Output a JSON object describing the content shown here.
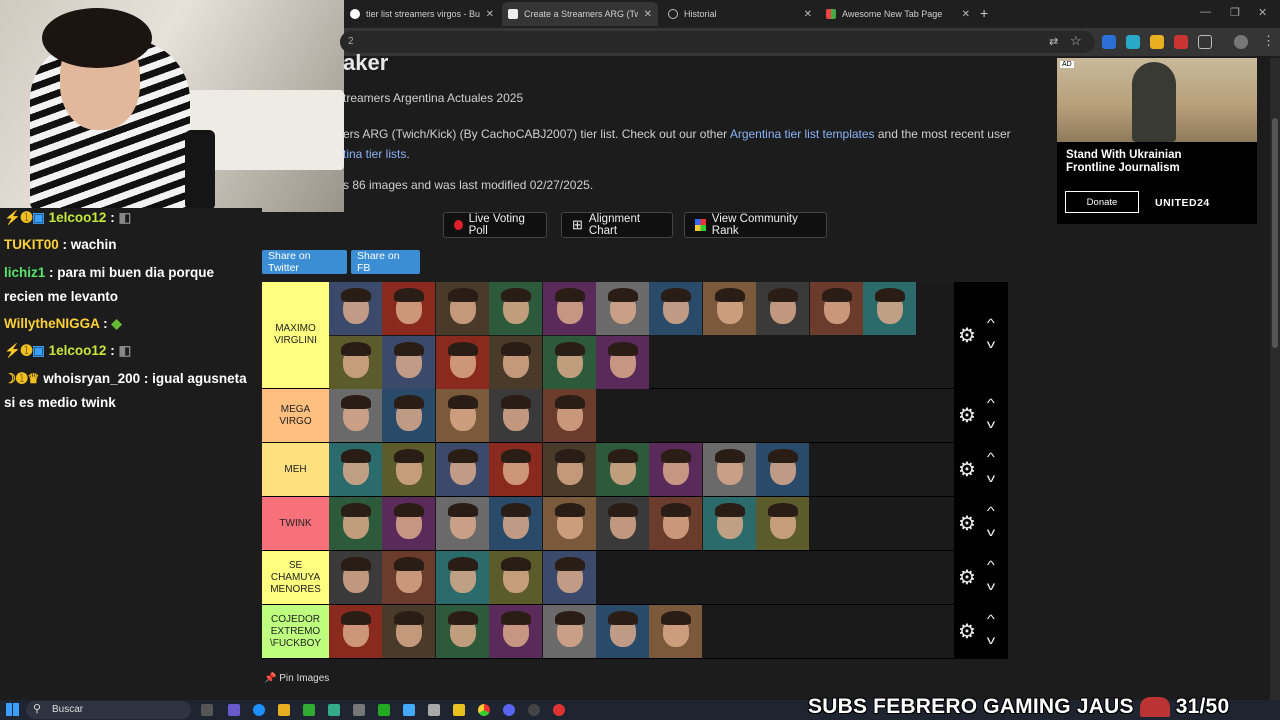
{
  "browser": {
    "tabs": [
      {
        "label": "tier list streamers virgos - Busca",
        "active": false
      },
      {
        "label": "Create a Streamers ARG (Twich/Kick)",
        "active": true
      },
      {
        "label": "Historial",
        "active": false
      },
      {
        "label": "Awesome New Tab Page",
        "active": false
      }
    ],
    "new_tab": "+",
    "url_fragment": "2"
  },
  "page": {
    "title_fragment": "aker",
    "subtitle": "treamers Argentina Actuales 2025",
    "desc_part1": "ers ARG (Twich/Kick) (By CachoCABJ2007) tier list. Check out our other ",
    "desc_link1": "Argentina tier list templates",
    "desc_part2": " and the most recent user",
    "desc_link2": "tina tier lists",
    "desc_part3": ".",
    "meta": "s 86 images and was last modified 02/27/2025.",
    "buttons": {
      "live_voting": "Live Voting Poll",
      "alignment": "Alignment Chart",
      "community": "View Community Rank"
    },
    "share": {
      "twitter": "Share on Twitter",
      "fb": "Share on FB"
    },
    "tiers": [
      {
        "label": "MAXIMO VIRGLINI",
        "color": "#ffff7f",
        "count": 17
      },
      {
        "label": "MEGA VIRGO",
        "color": "#ffbf7f",
        "count": 5
      },
      {
        "label": "MEH",
        "color": "#ffdf7f",
        "count": 9
      },
      {
        "label": "TWINK",
        "color": "#f7707a",
        "count": 9
      },
      {
        "label": "SE CHAMUYA MENORES",
        "color": "#ffff7f",
        "count": 5
      },
      {
        "label": "COJEDOR EXTREMO \\FUCKBOY",
        "color": "#bfff7f",
        "count": 7
      }
    ],
    "pin_images": "Pin Images"
  },
  "ad": {
    "tag": "AD",
    "headline": "Stand With Ukrainian Frontline Journalism",
    "donate": "Donate",
    "brand": "UNITED24"
  },
  "chat": [
    {
      "user": "1elcoo12",
      "text": "",
      "color": "#c6e83a"
    },
    {
      "user": "TUKIT00",
      "text": "wachin",
      "color": "#ffd23a"
    },
    {
      "user": "lichiz1",
      "text": "para mi buen dia porque recien me levanto",
      "color": "#59e36a"
    },
    {
      "user": "WillytheNIGGA",
      "text": "",
      "color": "#ffd23a"
    },
    {
      "user": "1elcoo12",
      "text": "",
      "color": "#c6e83a"
    },
    {
      "user": "whoisryan_200",
      "text": "igual agusneta si es medio twink",
      "color": "#e0e0e0"
    }
  ],
  "taskbar": {
    "search": "Buscar",
    "overlay": "SUBS FEBRERO GAMING JAUS",
    "counter": "31/50"
  },
  "colors": {
    "link": "#8ab4f8",
    "share_button": "#3b8dd4",
    "live_dot": "#e0202a"
  }
}
